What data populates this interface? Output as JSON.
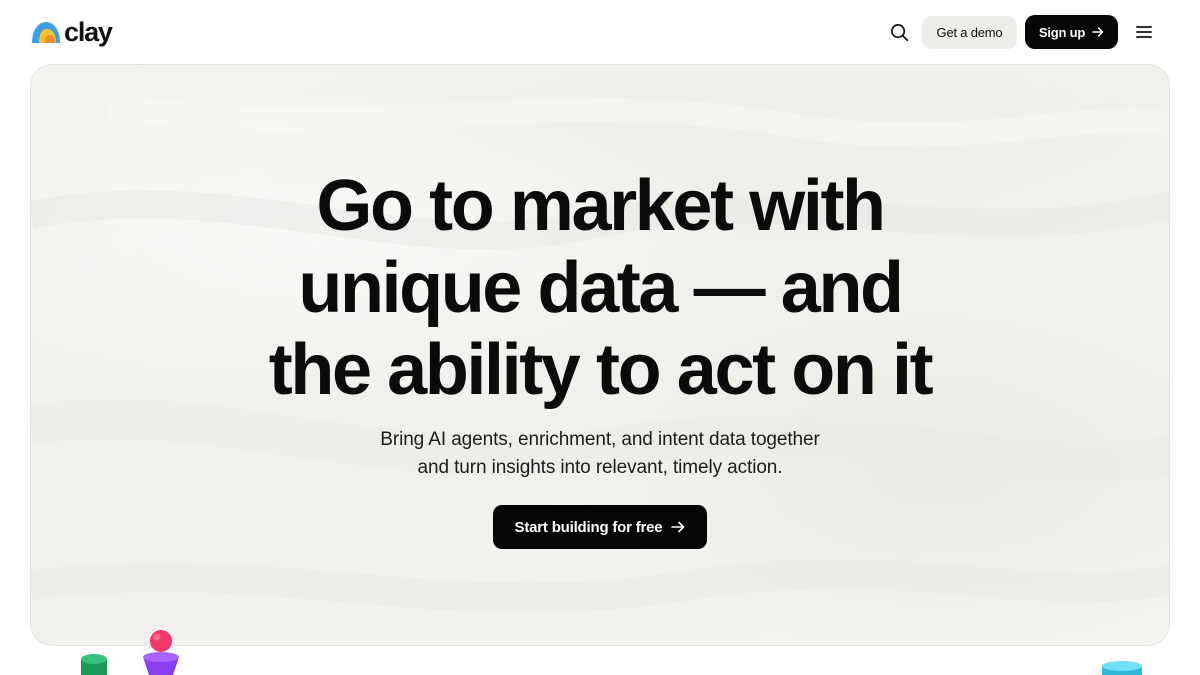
{
  "header": {
    "logo_text": "clay",
    "search_icon": "search-icon",
    "demo_label": "Get a demo",
    "signup_label": "Sign up",
    "signup_icon": "arrow-right-icon",
    "menu_icon": "hamburger-menu-icon"
  },
  "hero": {
    "headline_lines": [
      "Go to market with",
      "unique data — and",
      "the ability to act on it"
    ],
    "subhead_lines": [
      "Bring AI agents, enrichment, and intent data together",
      "and turn insights into relevant, timely action."
    ],
    "cta_label": "Start building for free",
    "cta_icon": "arrow-right-icon"
  },
  "colors": {
    "cta_background": "#050505",
    "demo_background": "#eeede9",
    "hero_background": "#f2f1ed",
    "logo_blue": "#3aa0e6",
    "logo_yellow": "#f6c22c",
    "logo_orange": "#f08a2a",
    "figure_green": "#1c9a5a",
    "figure_pink": "#f0386b",
    "figure_purple": "#8b3ff0",
    "figure_cyan": "#44d0ee"
  }
}
